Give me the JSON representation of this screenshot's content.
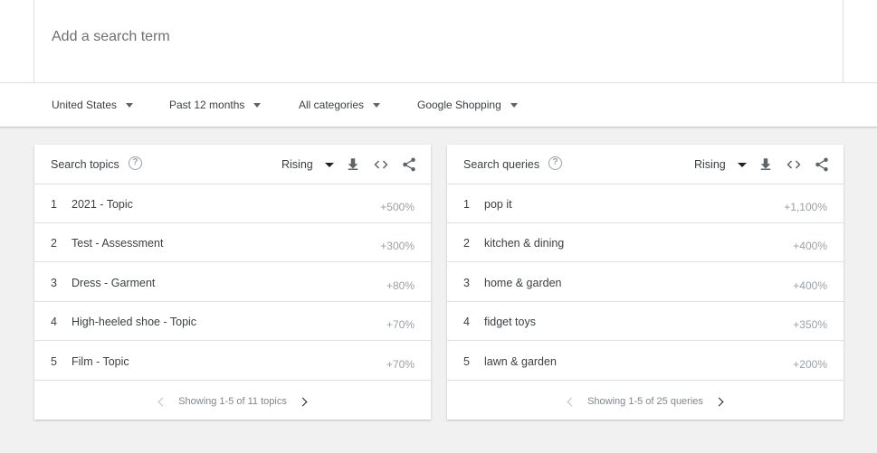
{
  "search": {
    "placeholder": "Add a search term"
  },
  "filters": [
    {
      "label": "United States"
    },
    {
      "label": "Past 12 months"
    },
    {
      "label": "All categories"
    },
    {
      "label": "Google Shopping"
    }
  ],
  "topics": {
    "title": "Search topics",
    "sort": "Rising",
    "rows": [
      {
        "rank": "1",
        "label": "2021 - Topic",
        "value": "+500%"
      },
      {
        "rank": "2",
        "label": "Test - Assessment",
        "value": "+300%"
      },
      {
        "rank": "3",
        "label": "Dress - Garment",
        "value": "+80%"
      },
      {
        "rank": "4",
        "label": "High-heeled shoe - Topic",
        "value": "+70%"
      },
      {
        "rank": "5",
        "label": "Film - Topic",
        "value": "+70%"
      }
    ],
    "pager": "Showing 1-5 of 11 topics"
  },
  "queries": {
    "title": "Search queries",
    "sort": "Rising",
    "rows": [
      {
        "rank": "1",
        "label": "pop it",
        "value": "+1,100%"
      },
      {
        "rank": "2",
        "label": "kitchen & dining",
        "value": "+400%"
      },
      {
        "rank": "3",
        "label": "home & garden",
        "value": "+400%"
      },
      {
        "rank": "4",
        "label": "fidget toys",
        "value": "+350%"
      },
      {
        "rank": "5",
        "label": "lawn & garden",
        "value": "+200%"
      }
    ],
    "pager": "Showing 1-5 of 25 queries"
  },
  "icons": [
    "help-icon",
    "download-icon",
    "embed-icon",
    "share-icon",
    "chevron-left-icon",
    "chevron-right-icon",
    "caret-down-icon"
  ]
}
